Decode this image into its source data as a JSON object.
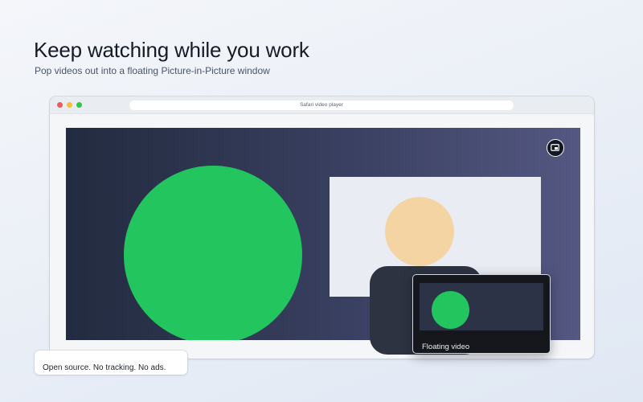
{
  "hero": {
    "headline": "Keep watching while you work",
    "subheadline": "Pop videos out into a floating Picture-in-Picture window"
  },
  "browser": {
    "url_text": "Safari video player",
    "traffic_lights": [
      "close",
      "minimize",
      "zoom"
    ]
  },
  "player": {
    "pip_button_icon": "picture-in-picture-icon"
  },
  "pip": {
    "label": "Floating video"
  },
  "badge": {
    "text": "Open source. No tracking. No ads."
  },
  "colors": {
    "accent_green": "#22c55e",
    "video_gradient_start": "#222b3f",
    "video_gradient_end": "#545882",
    "skin": "#f5d4a3",
    "pip_background": "#15171c"
  }
}
